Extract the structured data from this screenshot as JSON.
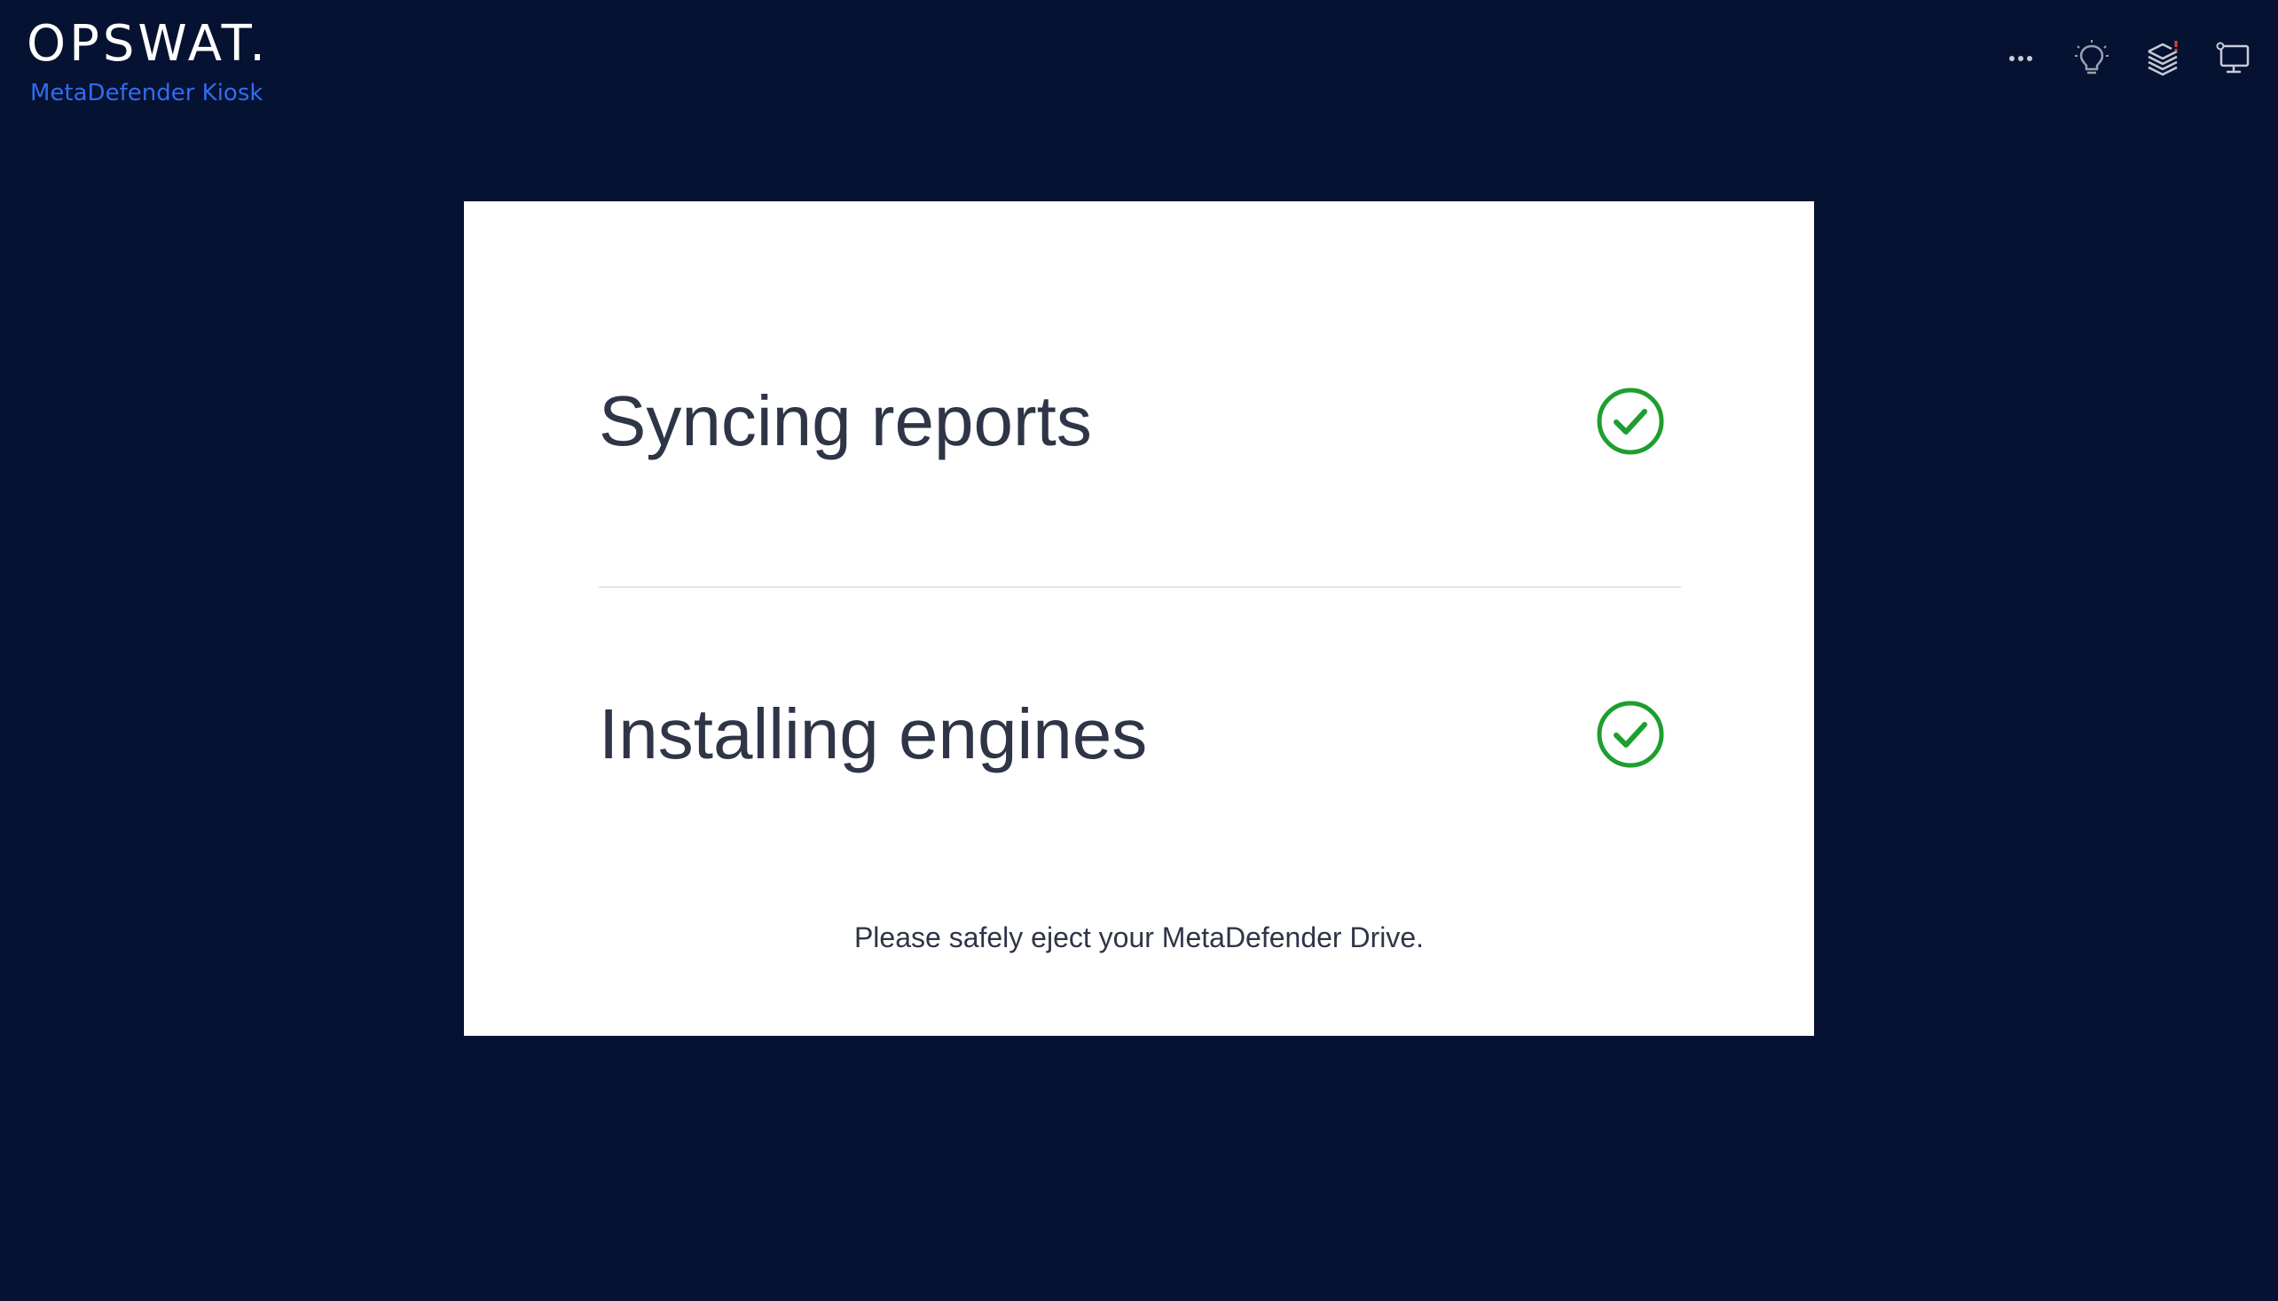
{
  "header": {
    "logo_text": "OPSWAT.",
    "product_name": "MetaDefender Kiosk"
  },
  "toolbar": {
    "icons": [
      "more-icon",
      "lightbulb-icon",
      "layers-alert-icon",
      "monitor-icon"
    ]
  },
  "dialog": {
    "steps": [
      {
        "label": "Syncing reports",
        "status": "complete"
      },
      {
        "label": "Installing engines",
        "status": "complete"
      }
    ],
    "message": "Please safely eject your MetaDefender Drive."
  },
  "colors": {
    "background": "#061232",
    "accent_blue": "#2f6cf0",
    "success_green": "#1e9e2e",
    "text_dark": "#2e3546",
    "alert_red": "#e0452b"
  }
}
